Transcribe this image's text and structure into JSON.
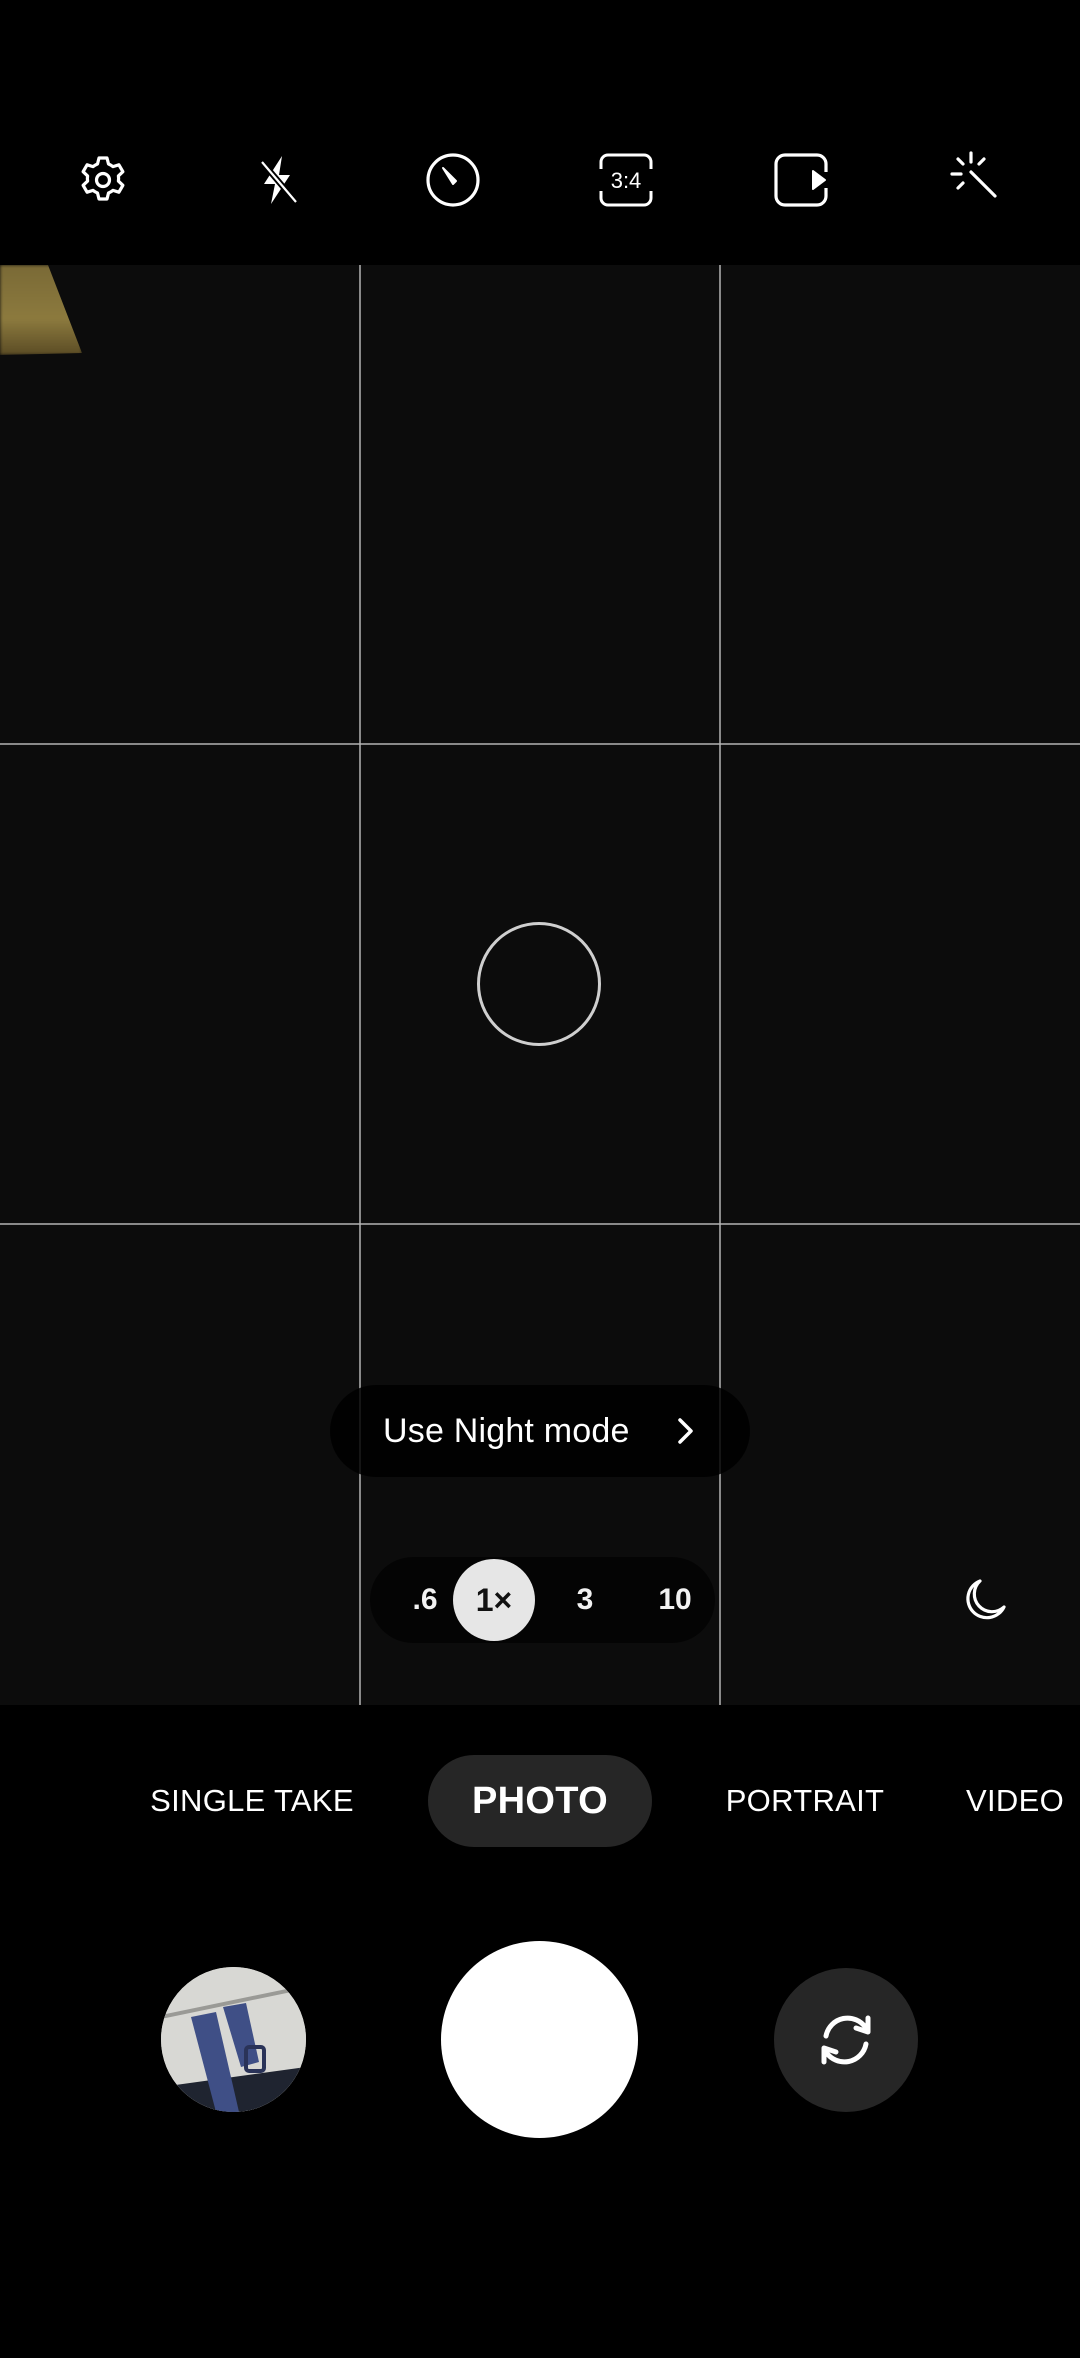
{
  "toolbar": {
    "items": [
      {
        "name": "settings",
        "icon": "gear-icon"
      },
      {
        "name": "flash",
        "icon": "flash-off-icon",
        "state": "off"
      },
      {
        "name": "timer",
        "icon": "timer-icon"
      },
      {
        "name": "aspect-ratio",
        "icon": "aspect-ratio-icon",
        "label": "3:4"
      },
      {
        "name": "motion-photo",
        "icon": "motion-photo-icon"
      },
      {
        "name": "filters",
        "icon": "magic-wand-icon"
      }
    ]
  },
  "viewfinder": {
    "grid": "3x3",
    "suggestion": {
      "label": "Use Night mode",
      "icon": "chevron-right-icon"
    },
    "zoom": {
      "options": [
        ".6",
        "1×",
        "3",
        "10"
      ],
      "selected": "1×"
    },
    "night_toggle_icon": "moon-icon"
  },
  "modes": {
    "items": [
      "SINGLE TAKE",
      "PHOTO",
      "PORTRAIT",
      "VIDEO"
    ],
    "selected": "PHOTO"
  },
  "controls": {
    "gallery_icon": "gallery-thumbnail",
    "shutter_icon": "shutter-button",
    "switch_icon": "switch-camera-icon"
  }
}
